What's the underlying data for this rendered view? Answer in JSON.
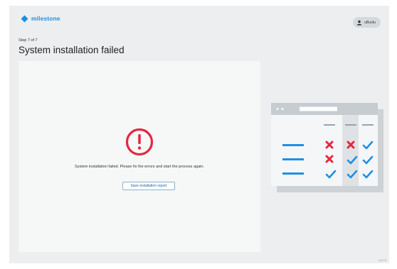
{
  "header": {
    "brand": "milestone",
    "user_name": "uBuntu"
  },
  "main": {
    "step_label": "Step 7 of 7",
    "title": "System installation failed",
    "message": "System installation failed. Please fix the errors and start the process again.",
    "save_report_label": "Save installation report"
  },
  "footer": {
    "version": "v1.0.0"
  },
  "colors": {
    "brand": "#1f8fe0",
    "error": "#e4283f",
    "check": "#1f8fe0",
    "background": "#eceeef"
  },
  "icons": {
    "logo": "milestone-diamond-icon",
    "user": "user-icon",
    "error": "error-circle-exclamation-icon",
    "illustration": "checklist-illustration"
  }
}
